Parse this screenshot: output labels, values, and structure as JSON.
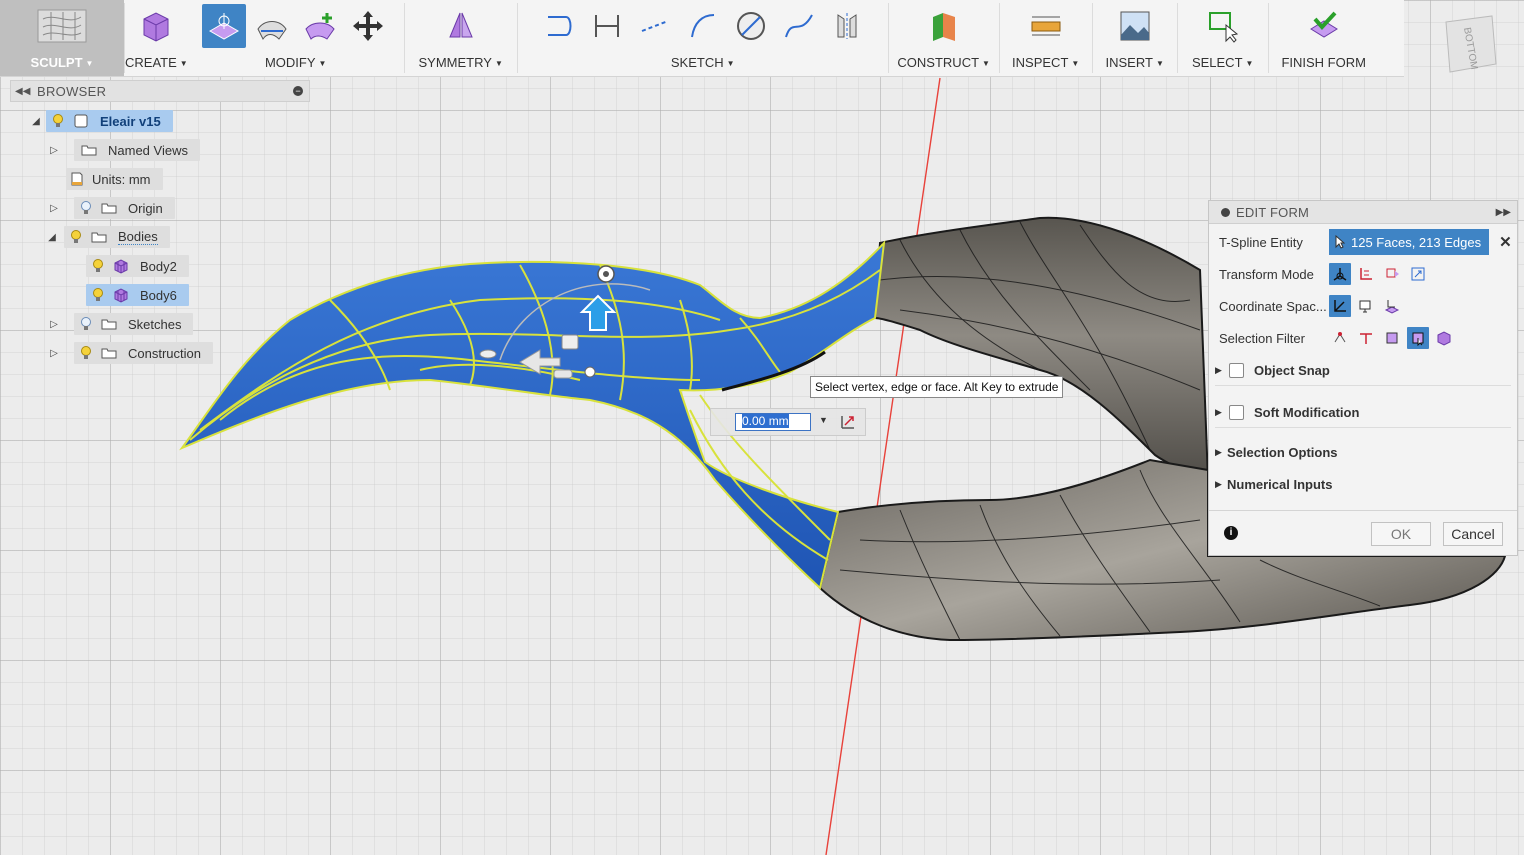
{
  "toolbar": {
    "workspace": "SCULPT",
    "groups": {
      "create": "CREATE",
      "modify": "MODIFY",
      "symmetry": "SYMMETRY",
      "sketch": "SKETCH",
      "construct": "CONSTRUCT",
      "inspect": "INSPECT",
      "insert": "INSERT",
      "select": "SELECT",
      "finish": "FINISH FORM"
    }
  },
  "viewcube": {
    "face_label": "BOTTOM"
  },
  "browser": {
    "title": "BROWSER",
    "items": [
      {
        "label": "Eleair v15",
        "type": "document"
      },
      {
        "label": "Named Views",
        "type": "folder"
      },
      {
        "label": "Units: mm",
        "type": "units"
      },
      {
        "label": "Origin",
        "type": "folder"
      },
      {
        "label": "Bodies",
        "type": "folder"
      },
      {
        "label": "Body2",
        "type": "body"
      },
      {
        "label": "Body6",
        "type": "body"
      },
      {
        "label": "Sketches",
        "type": "folder"
      },
      {
        "label": "Construction",
        "type": "folder"
      }
    ]
  },
  "viewport": {
    "tooltip": "Select vertex, edge or face. Alt Key to extrude",
    "distance_input": "0.00 mm",
    "colors": {
      "selected_body": "#2f68c8",
      "edges": "#d8e23c",
      "body": "#6f6c66",
      "axis": "#e8413a"
    }
  },
  "edit_form": {
    "title": "EDIT FORM",
    "tspline_entity": {
      "label": "T-Spline Entity",
      "value": "125 Faces, 213 Edges"
    },
    "transform_mode": "Transform Mode",
    "coordinate_space": "Coordinate Spac...",
    "selection_filter": "Selection Filter",
    "object_snap": "Object Snap",
    "soft_modification": "Soft Modification",
    "selection_options": "Selection Options",
    "numerical_inputs": "Numerical Inputs",
    "ok": "OK",
    "cancel": "Cancel"
  }
}
